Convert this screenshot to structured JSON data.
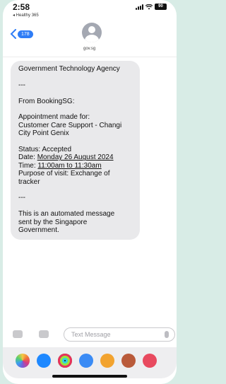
{
  "status_bar": {
    "time": "2:58",
    "back_app": "◂ Healthy 365",
    "battery": "90"
  },
  "header": {
    "unread_count": "178",
    "contact": "gov.sg"
  },
  "message": {
    "lines": [
      "Government Technology Agency",
      "",
      "---",
      "",
      "From BookingSG:",
      "",
      "Appointment made for:",
      "Customer Care Support - Changi",
      "City Point Genix",
      "",
      "Status: Accepted",
      "Date: ",
      "Time: ",
      "Purpose of visit: Exchange of",
      "tracker",
      "",
      "---",
      "",
      "This is an automated message",
      "sent by the Singapore",
      "Government."
    ],
    "date_value": "Monday 26 August 2024",
    "time_value": "11:00am to 11:30am"
  },
  "compose": {
    "placeholder": "Text Message"
  },
  "icons": {
    "photos": "photos-icon",
    "appstore": "appstore-icon",
    "fitness": "fitness-icon",
    "audio": "audio-message-icon",
    "memoji1": "memoji-icon",
    "memoji2": "memoji-icon",
    "search": "search-icon"
  },
  "colors": {
    "accent": "#2f7df6",
    "bubble": "#e9e9eb",
    "background": "#d8ece6"
  }
}
